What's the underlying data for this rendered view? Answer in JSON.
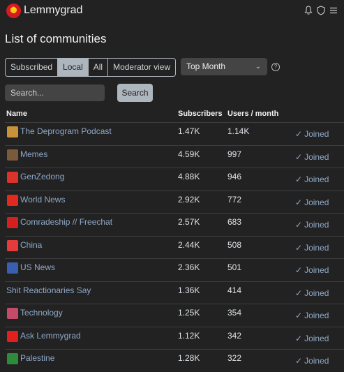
{
  "brand": {
    "name": "Lemmygrad"
  },
  "nav": {
    "icons": [
      "bell-icon",
      "shield-icon",
      "menu-icon"
    ]
  },
  "page": {
    "title": "List of communities"
  },
  "listing_tabs": [
    {
      "label": "Subscribed",
      "active": false
    },
    {
      "label": "Local",
      "active": true
    },
    {
      "label": "All",
      "active": false
    },
    {
      "label": "Moderator view",
      "active": false
    }
  ],
  "sort": {
    "selected": "Top Month"
  },
  "search": {
    "placeholder": "Search...",
    "button_label": "Search"
  },
  "table": {
    "headers": {
      "name": "Name",
      "subscribers": "Subscribers",
      "users_month": "Users / month"
    },
    "joined_label": "Joined",
    "rows": [
      {
        "name": "The Deprogram Podcast",
        "subscribers": "1.47K",
        "users": "1.14K",
        "icon_color": "#c8923a"
      },
      {
        "name": "Memes",
        "subscribers": "4.59K",
        "users": "997",
        "icon_color": "#7a5a3a"
      },
      {
        "name": "GenZedong",
        "subscribers": "4.88K",
        "users": "946",
        "icon_color": "#d9332c"
      },
      {
        "name": "World News",
        "subscribers": "2.92K",
        "users": "772",
        "icon_color": "#e02a20"
      },
      {
        "name": "Comradeship // Freechat",
        "subscribers": "2.57K",
        "users": "683",
        "icon_color": "#d62020"
      },
      {
        "name": "China",
        "subscribers": "2.44K",
        "users": "508",
        "icon_color": "#e23c3c"
      },
      {
        "name": "US News",
        "subscribers": "2.36K",
        "users": "501",
        "icon_color": "#3a5fb0"
      },
      {
        "name": "Shit Reactionaries Say",
        "subscribers": "1.36K",
        "users": "414",
        "icon_color": ""
      },
      {
        "name": "Technology",
        "subscribers": "1.25K",
        "users": "354",
        "icon_color": "#c44a6a"
      },
      {
        "name": "Ask Lemmygrad",
        "subscribers": "1.12K",
        "users": "342",
        "icon_color": "#e0201c"
      },
      {
        "name": "Palestine",
        "subscribers": "1.28K",
        "users": "322",
        "icon_color": "#2e8b3a"
      }
    ]
  }
}
